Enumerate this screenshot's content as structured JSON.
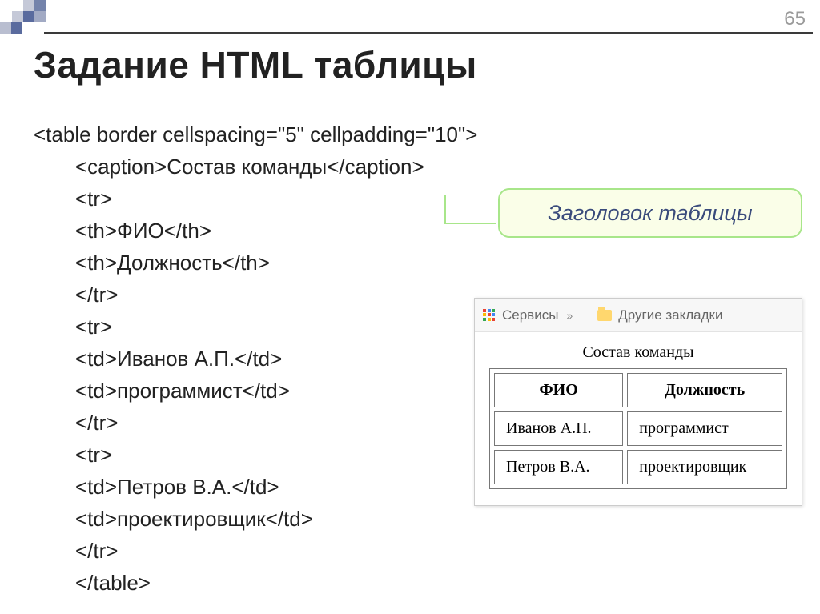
{
  "page_number": "65",
  "slide_title": "Задание HTML таблицы",
  "code": {
    "line1": "<table border cellspacing=\"5\" cellpadding=\"10\">",
    "line2": "<caption>Состав команды</caption>",
    "line3": "<tr>",
    "line4": "<th>ФИО</th>",
    "line5": "<th>Должность</th>",
    "line6": "</tr>",
    "line7": "<tr>",
    "line8": "<td>Иванов А.П.</td>",
    "line9": "<td>программист</td>",
    "line10": "</tr>",
    "line11": "<tr>",
    "line12": "<td>Петров В.А.</td>",
    "line13": "<td>проектировщик</td>",
    "line14": "</tr>",
    "line15": "</table>"
  },
  "callout_text": "Заголовок таблицы",
  "browser": {
    "services_label": "Сервисы",
    "other_bookmarks": "Другие закладки"
  },
  "rendered": {
    "caption": "Состав команды",
    "headers": {
      "c1": "ФИО",
      "c2": "Должность"
    },
    "rows": [
      {
        "c1": "Иванов А.П.",
        "c2": "программист"
      },
      {
        "c1": "Петров В.А.",
        "c2": "проектировщик"
      }
    ]
  }
}
